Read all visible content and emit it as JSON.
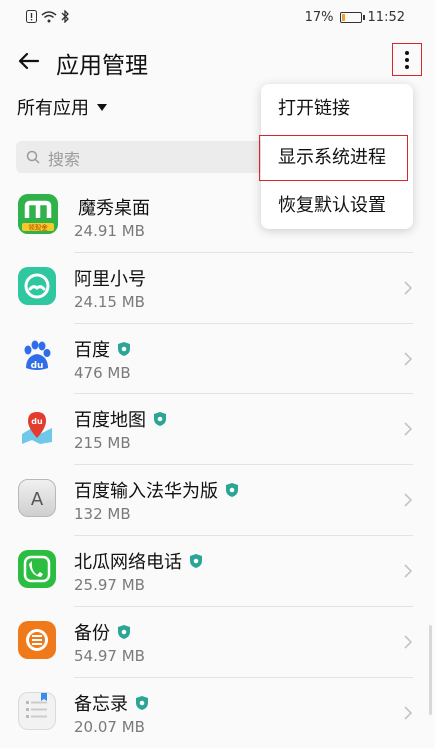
{
  "status_bar": {
    "battery_percent": "17%",
    "time": "11:52",
    "battery_level": 0.17
  },
  "header": {
    "title": "应用管理"
  },
  "filter": {
    "label": "所有应用"
  },
  "search": {
    "placeholder": "搜索"
  },
  "menu": {
    "items": [
      {
        "label": "打开链接"
      },
      {
        "label": "显示系统进程"
      },
      {
        "label": "恢复默认设置"
      }
    ]
  },
  "apps": [
    {
      "name": "魔秀桌面",
      "size": "24.91 MB",
      "icon": "moxiu-icon",
      "color": "#2fb24a",
      "badge": false,
      "icon_text": "领现金"
    },
    {
      "name": "阿里小号",
      "size": "24.15 MB",
      "icon": "ali-xiaohao-icon",
      "color": "#2ec7a0",
      "badge": false
    },
    {
      "name": "百度",
      "size": "476 MB",
      "icon": "baidu-icon",
      "color": "#2f6ee8",
      "badge": true
    },
    {
      "name": "百度地图",
      "size": "215 MB",
      "icon": "baidu-map-icon",
      "color": "#e33b2e",
      "badge": true
    },
    {
      "name": "百度输入法华为版",
      "size": "132 MB",
      "icon": "keyboard-a-icon",
      "color": "#d9d9d9",
      "badge": true
    },
    {
      "name": "北瓜网络电话",
      "size": "25.97 MB",
      "icon": "phone-icon",
      "color": "#2bbd3f",
      "badge": true
    },
    {
      "name": "备份",
      "size": "54.97 MB",
      "icon": "backup-icon",
      "color": "#f07a1a",
      "badge": true
    },
    {
      "name": "备忘录",
      "size": "20.07 MB",
      "icon": "memo-icon",
      "color": "#ededed",
      "badge": true
    }
  ]
}
